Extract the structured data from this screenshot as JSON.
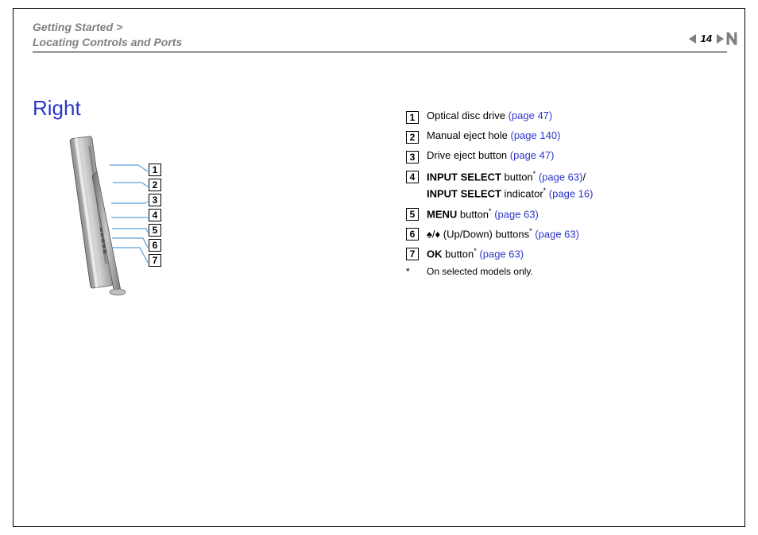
{
  "header": {
    "line1": "Getting Started >",
    "line2": "Locating Controls and Ports"
  },
  "page_number": "14",
  "section_title": "Right",
  "callout_numbers": [
    "1",
    "2",
    "3",
    "4",
    "5",
    "6",
    "7"
  ],
  "legend": [
    {
      "num": "1",
      "text": "Optical disc drive ",
      "link": "(page 47)"
    },
    {
      "num": "2",
      "text": "Manual eject hole ",
      "link": "(page 140)"
    },
    {
      "num": "3",
      "text": "Drive eject button ",
      "link": "(page 47)"
    },
    {
      "num": "4",
      "bold1": "INPUT SELECT",
      "after1": " button",
      "sup1": "*",
      "link1": "(page 63)",
      "slash": "/",
      "bold2": "INPUT SELECT",
      "after2": " indicator",
      "sup2": "*",
      "link2": "(page 16)"
    },
    {
      "num": "5",
      "bold1": "MENU",
      "after1": " button",
      "sup1": "*",
      "link1": "(page 63)"
    },
    {
      "num": "6",
      "text": "♠/♦ (Up/Down) buttons",
      "sup1": "*",
      "link1": "(page 63)"
    },
    {
      "num": "7",
      "bold1": "OK",
      "after1": " button",
      "sup1": "*",
      "link1": "(page 63)"
    }
  ],
  "footnote": {
    "star": "*",
    "text": "On selected models only."
  }
}
